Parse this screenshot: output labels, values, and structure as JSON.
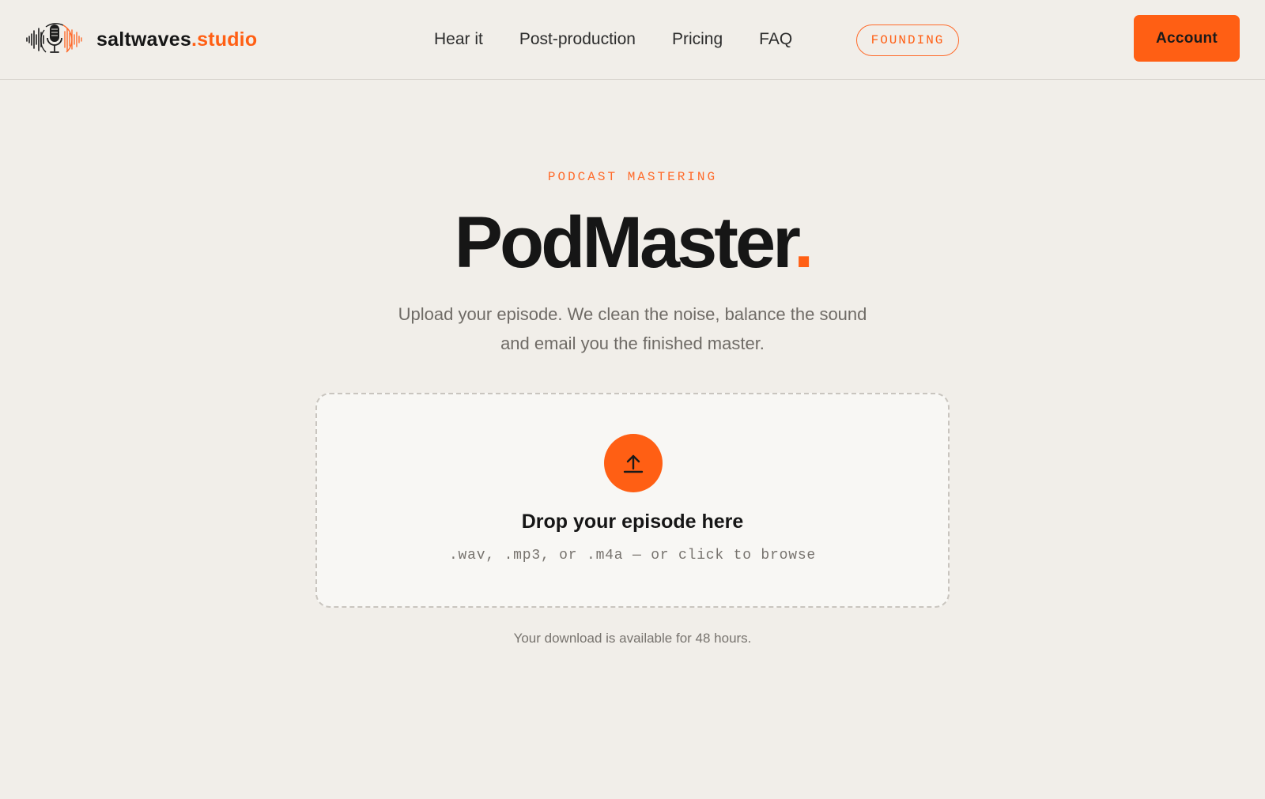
{
  "brand": {
    "name": "saltwaves",
    "accent": ".studio",
    "logo_icon": "microphone-waveform-icon"
  },
  "nav": {
    "links": [
      "Hear it",
      "Post-production",
      "Pricing",
      "FAQ"
    ],
    "badge": "FOUNDING",
    "account_label": "Account"
  },
  "hero": {
    "eyebrow": "PODCAST MASTERING",
    "title": "PodMaster",
    "title_dot": ".",
    "subtitle": "Upload your episode. We clean the noise, balance the sound and email you the finished master."
  },
  "dropzone": {
    "icon": "upload-arrow-icon",
    "title": "Drop your episode here",
    "hint": ".wav, .mp3, or .m4a — or click to browse"
  },
  "footnote": "Your download is available for 48 hours.",
  "colors": {
    "accent": "#ff5f14",
    "background": "#f1eee9",
    "text": "#161616",
    "muted": "#77736e"
  }
}
